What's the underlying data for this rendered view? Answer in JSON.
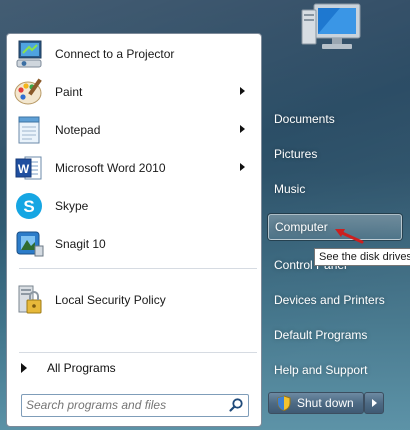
{
  "programs": [
    {
      "label": "Connect to a Projector",
      "icon": "projector-icon",
      "has_submenu": false
    },
    {
      "label": "Paint",
      "icon": "paint-icon",
      "has_submenu": true
    },
    {
      "label": "Notepad",
      "icon": "notepad-icon",
      "has_submenu": true
    },
    {
      "label": "Microsoft Word 2010",
      "icon": "word-icon",
      "has_submenu": true
    },
    {
      "label": "Skype",
      "icon": "skype-icon",
      "has_submenu": false
    },
    {
      "label": "Snagit 10",
      "icon": "snagit-icon",
      "has_submenu": false
    },
    {
      "label": "Local Security Policy",
      "icon": "security-policy-icon",
      "has_submenu": false
    }
  ],
  "all_programs_label": "All Programs",
  "search": {
    "placeholder": "Search programs and files"
  },
  "right_items": [
    {
      "label": "Documents"
    },
    {
      "label": "Pictures"
    },
    {
      "label": "Music"
    },
    {
      "label": "Computer",
      "highlighted": true
    },
    {
      "label": "Control Panel"
    },
    {
      "label": "Devices and Printers"
    },
    {
      "label": "Default Programs"
    },
    {
      "label": "Help and Support"
    }
  ],
  "tooltip": {
    "text": "See the disk drives"
  },
  "shutdown": {
    "label": "Shut down"
  },
  "colors": {
    "annotation_arrow": "#cc1f1f",
    "highlight_border": "#ffffff"
  }
}
